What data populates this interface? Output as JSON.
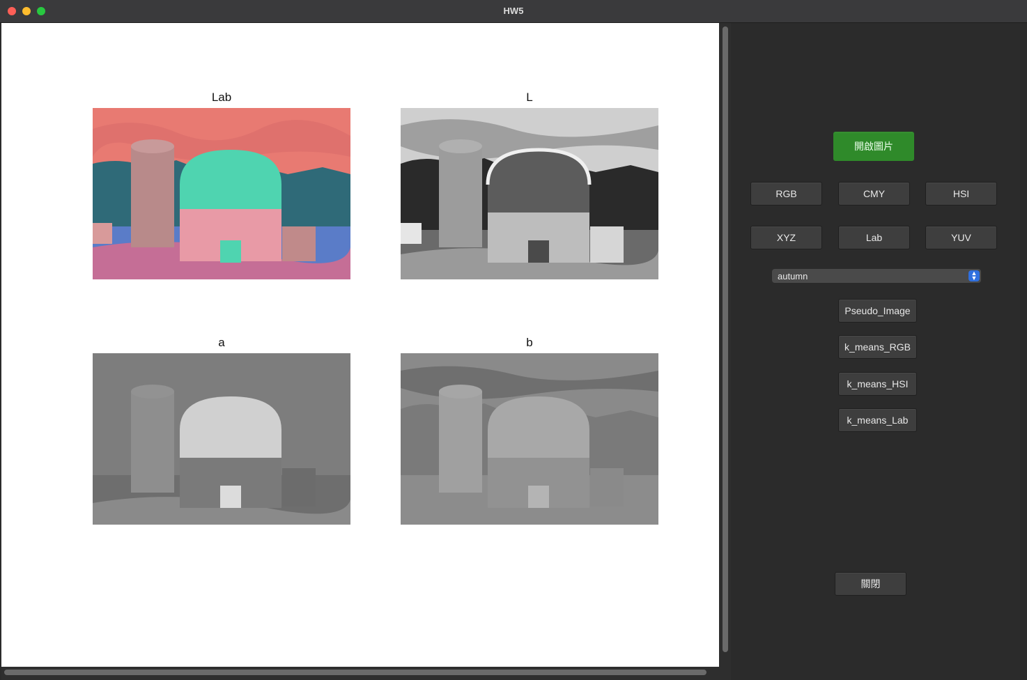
{
  "window": {
    "title": "HW5"
  },
  "plots": [
    {
      "title": "Lab"
    },
    {
      "title": "L"
    },
    {
      "title": "a"
    },
    {
      "title": "b"
    }
  ],
  "panel": {
    "open_button": "開啟圖片",
    "color_buttons": [
      "RGB",
      "CMY",
      "HSI",
      "XYZ",
      "Lab",
      "YUV"
    ],
    "colormap_select": {
      "value": "autumn"
    },
    "action_buttons": [
      "Pseudo_Image",
      "k_means_RGB",
      "k_means_HSI",
      "k_means_Lab"
    ],
    "close_button": "關閉"
  },
  "colors": {
    "open_button": "#2f8a2a",
    "window_bg": "#2b2b2b",
    "canvas_bg": "#ffffff"
  },
  "icons": [
    "window-close-icon",
    "window-minimize-icon",
    "window-zoom-icon",
    "select-arrows-icon"
  ]
}
